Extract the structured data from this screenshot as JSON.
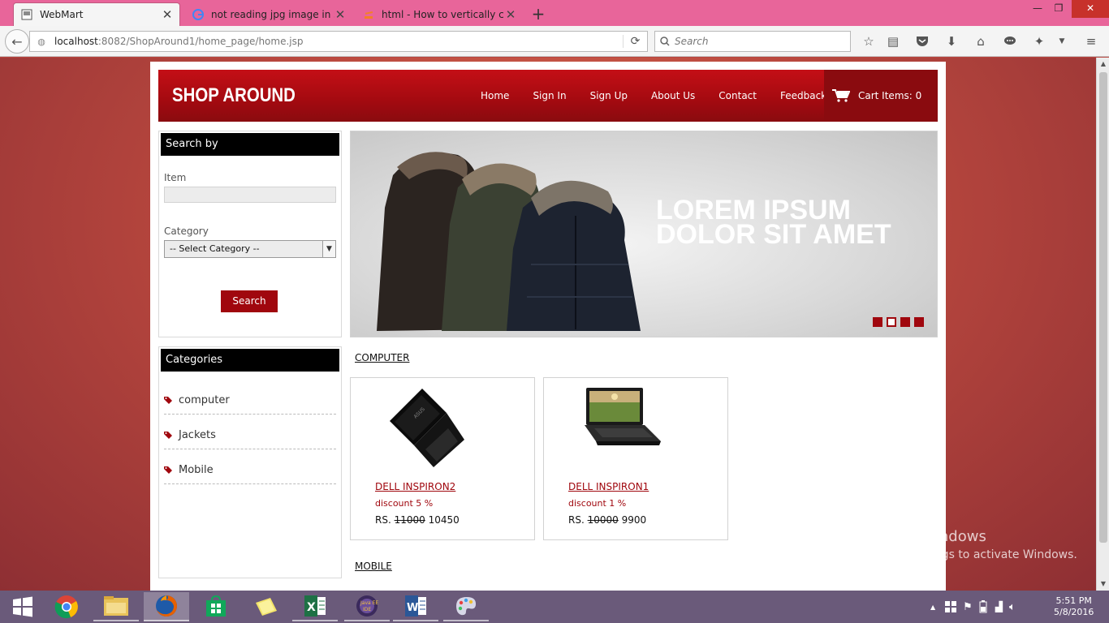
{
  "browser": {
    "tabs": [
      {
        "title": "WebMart",
        "active": true
      },
      {
        "title": "not reading jpg image in s...",
        "active": false
      },
      {
        "title": "html - How to vertically c...",
        "active": false
      }
    ],
    "url_host": "localhost",
    "url_rest": ":8082/ShopAround1/home_page/home.jsp",
    "search_placeholder": "Search"
  },
  "site": {
    "logo": "SHOP AROUND",
    "nav": [
      "Home",
      "Sign In",
      "Sign Up",
      "About Us",
      "Contact",
      "Feedback"
    ],
    "cart_label": "Cart Items: 0",
    "accent": "#a0070e"
  },
  "search_panel": {
    "title": "Search by",
    "item_label": "Item",
    "category_label": "Category",
    "category_selected": "-- Select Category --",
    "button": "Search"
  },
  "categories_panel": {
    "title": "Categories",
    "items": [
      "computer",
      "Jackets",
      "Mobile"
    ]
  },
  "banner": {
    "headline": "LOREM IPSUM DOLOR SIT AMET",
    "slide_count": 4,
    "active_slide": 2
  },
  "sections": [
    {
      "title": "COMPUTER",
      "products": [
        {
          "name": "DELL INSPIRON2",
          "discount": "discount 5 %",
          "currency": "RS.",
          "old_price": "11000",
          "price": "10450"
        },
        {
          "name": "DELL INSPIRON1",
          "discount": "discount 1 %",
          "currency": "RS.",
          "old_price": "10000",
          "price": "9900"
        }
      ]
    },
    {
      "title": "MOBILE",
      "products": []
    }
  ],
  "watermark": {
    "line1": "Activate Windows",
    "line2": "Go to PC settings to activate Windows."
  },
  "taskbar": {
    "time": "5:51 PM",
    "date": "5/8/2016"
  }
}
